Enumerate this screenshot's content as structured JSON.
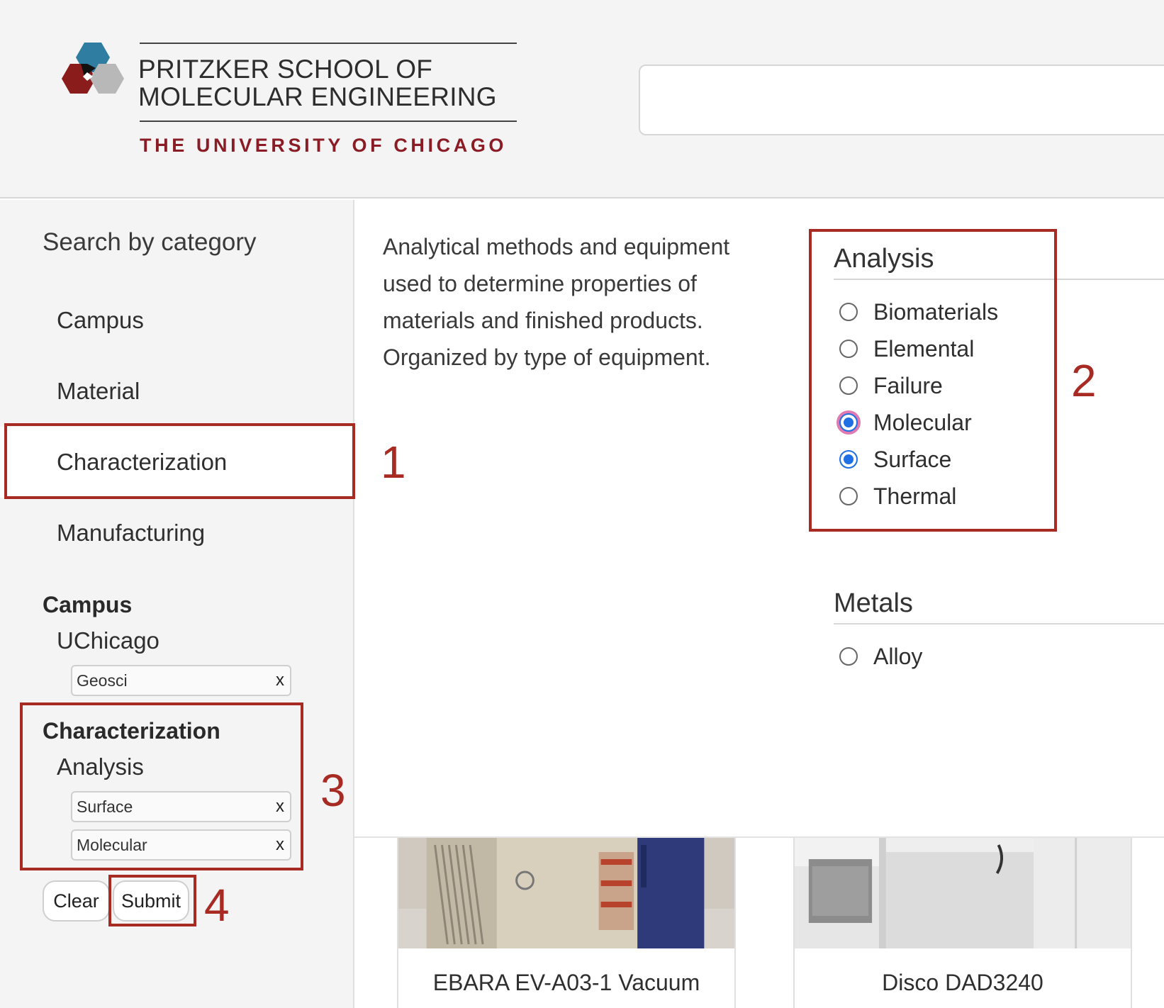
{
  "header": {
    "logo_line1": "PRITZKER SCHOOL OF",
    "logo_line2": "MOLECULAR ENGINEERING",
    "logo_sub": "THE UNIVERSITY OF CHICAGO",
    "search_value": ""
  },
  "sidebar": {
    "heading": "Search by category",
    "categories": [
      {
        "label": "Campus",
        "active": false
      },
      {
        "label": "Material",
        "active": false
      },
      {
        "label": "Characterization",
        "active": true
      },
      {
        "label": "Manufacturing",
        "active": false
      }
    ],
    "selected": [
      {
        "group": "Campus",
        "sub": "UChicago",
        "chips": [
          "Geosci"
        ]
      },
      {
        "group": "Characterization",
        "sub": "Analysis",
        "chips": [
          "Surface",
          "Molecular"
        ]
      }
    ],
    "chip_remove": "x",
    "clear_label": "Clear",
    "submit_label": "Submit"
  },
  "main": {
    "description": "Analytical methods and equipment used to determine properties of materials and finished products. Organized by type of equipment.",
    "facets": [
      {
        "title": "Analysis",
        "options": [
          {
            "label": "Biomaterials",
            "checked": false
          },
          {
            "label": "Elemental",
            "checked": false
          },
          {
            "label": "Failure",
            "checked": false
          },
          {
            "label": "Molecular",
            "checked": true,
            "focused": true
          },
          {
            "label": "Surface",
            "checked": true
          },
          {
            "label": "Thermal",
            "checked": false
          }
        ]
      },
      {
        "title": "Metals",
        "options": [
          {
            "label": "Alloy",
            "checked": false
          }
        ]
      }
    ],
    "cards": [
      {
        "title": "EBARA EV-A03-1 Vacuum"
      },
      {
        "title": "Disco DAD3240"
      }
    ]
  },
  "annotations": [
    "1",
    "2",
    "3",
    "4"
  ],
  "colors": {
    "annotation": "#a72b22",
    "brand_red": "#8a1c25",
    "brand_blue": "#2f7ea1",
    "radio_checked": "#1f6fe5",
    "focus_ring": "#e07ab0"
  }
}
